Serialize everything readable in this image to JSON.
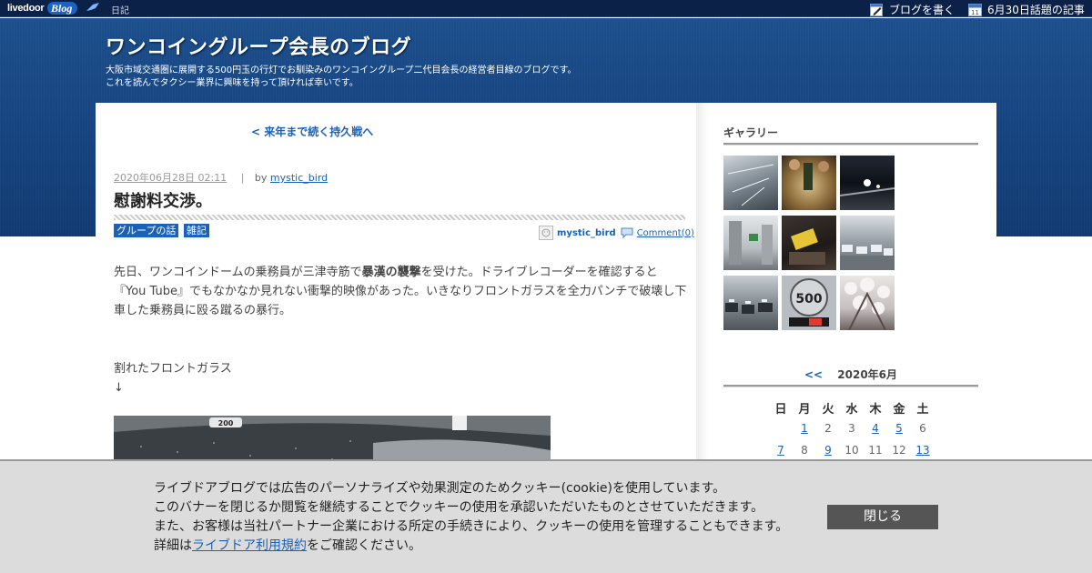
{
  "topbar": {
    "logo_main": "livedoor",
    "logo_sub": "Blog",
    "diary": "日記",
    "write_blog": "ブログを書く",
    "topic_articles": "6月30日話題の記事",
    "calendar_icon_day": "11"
  },
  "header": {
    "title": "ワンコイングループ会長のブログ",
    "desc_line1": "大阪市域交通圏に展開する500円玉の行灯でお馴染みのワンコイングループ二代目会長の経営者目線のブログです。",
    "desc_line2": "これを読んでタクシー業界に興味を持って頂ければ幸いです。"
  },
  "post": {
    "prev_link": "< 来年まで続く持久戦へ",
    "date": "2020年06月28日 02:11",
    "by": "by",
    "separator": "|",
    "author": "mystic_bird",
    "title": "慰謝料交渉。",
    "tags": [
      "グループの話",
      "雑記"
    ],
    "author_box_name": "mystic_bird",
    "comment": "Comment(0)",
    "body_before": "先日、ワンコインドームの乗務員が三津寺筋で",
    "body_bold": "暴漢の襲撃",
    "body_after": "を受けた。ドライブレコーダーを確認すると『You Tube』でもなかなか見れない衝撃的映像があった。いきなりフロントガラスを全力パンチで破壊し下車した乗務員に殴る蹴るの暴行。",
    "caption": "割れたフロントガラス",
    "arrow": "↓",
    "image_sign": "200"
  },
  "sidebar": {
    "gallery_heading": "ギャラリー",
    "thumb_sign_number": "500",
    "calendar": {
      "prev": "<<",
      "month_label": "2020年6月",
      "weekdays": [
        "日",
        "月",
        "火",
        "水",
        "木",
        "金",
        "土"
      ],
      "row1": [
        "",
        "1",
        "2",
        "3",
        "4",
        "5",
        "6"
      ],
      "row2": [
        "7",
        "8",
        "9",
        "10",
        "11",
        "12",
        "13"
      ],
      "linked_days": [
        "1",
        "4",
        "5",
        "7",
        "9",
        "13"
      ]
    }
  },
  "cookie": {
    "line1": "ライブドアブログでは広告のパーソナライズや効果測定のためクッキー(cookie)を使用しています。",
    "line2": "このバナーを閉じるか閲覧を継続することでクッキーの使用を承認いただいたものとさせていただきます。",
    "line3": "また、お客様は当社パートナー企業における所定の手続きにより、クッキーの使用を管理することもできます。",
    "line4_prefix": "詳細は",
    "line4_link": "ライブドア利用規約",
    "line4_suffix": "をご確認ください。",
    "close_label": "閉じる"
  },
  "colors": {
    "link": "#1a62b8",
    "header_blue": "#174682",
    "topbar": "#0b2147",
    "close_button": "#555555"
  }
}
